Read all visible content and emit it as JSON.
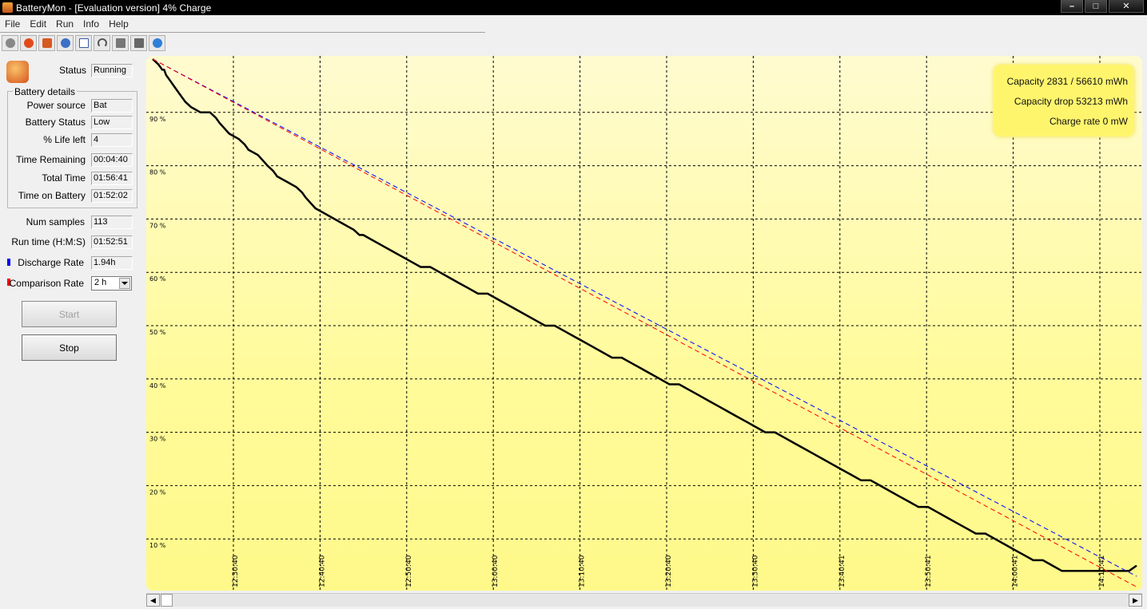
{
  "window": {
    "title": "BatteryMon - [Evaluation version] 4% Charge",
    "controls": [
      "–",
      "□",
      "✕"
    ]
  },
  "menu": [
    "File",
    "Edit",
    "Run",
    "Info",
    "Help"
  ],
  "toolbar": [
    "record-icon",
    "stop-icon",
    "battery-icon",
    "settings-icon",
    "checklist-icon",
    "gauge-icon",
    "chart-icon",
    "arrow-icon",
    "help-icon"
  ],
  "status": {
    "label": "Status",
    "value": "Running"
  },
  "battery_details": {
    "title": "Battery details",
    "fields": [
      {
        "label": "Power source",
        "value": "Bat"
      },
      {
        "label": "Battery Status",
        "value": "Low"
      },
      {
        "label": "% Life left",
        "value": "4"
      },
      {
        "label": "Time Remaining",
        "value": "00:04:40"
      },
      {
        "label": "Total Time",
        "value": "01:56:41"
      },
      {
        "label": "Time on Battery",
        "value": "01:52:02"
      }
    ]
  },
  "stats": [
    {
      "label": "Num samples",
      "value": "113"
    },
    {
      "label": "Run time (H:M:S)",
      "value": "01:52:51"
    },
    {
      "label": "Discharge Rate",
      "value": "1.94h",
      "color": "#0000ff"
    },
    {
      "label": "Comparison Rate",
      "value": "2 h",
      "color": "#ff0000"
    }
  ],
  "buttons": {
    "start": "Start",
    "stop": "Stop"
  },
  "info_box": [
    "Capacity 2831 / 56610 mWh",
    "Capacity drop 53213 mWh",
    "Charge rate 0 mW"
  ],
  "chart_data": {
    "type": "line",
    "y_unit": "%",
    "ylim": [
      0,
      100
    ],
    "y_ticks": [
      "10 %",
      "20 %",
      "30 %",
      "40 %",
      "50 %",
      "60 %",
      "70 %",
      "80 %",
      "90 %"
    ],
    "x_ticks": [
      "12:30:40",
      "12:40:40",
      "12:50:40",
      "13:00:40",
      "13:10:40",
      "13:20:40",
      "13:30:40",
      "13:40:41",
      "13:50:41",
      "14:00:41",
      "14:10:41"
    ],
    "grid": true,
    "series": [
      {
        "color": "#000000",
        "x_minutes": [
          0,
          3,
          5,
          6,
          7,
          9,
          11,
          13,
          15,
          17,
          20,
          25,
          30,
          33,
          35,
          40,
          45,
          48,
          50,
          55,
          60,
          63,
          65,
          70,
          75,
          78,
          80,
          85,
          90,
          95,
          100,
          105,
          108,
          110,
          115,
          120,
          125,
          130,
          135,
          140,
          145,
          150,
          155,
          160,
          165,
          170,
          175,
          180,
          185,
          190,
          195,
          200,
          205,
          210,
          215,
          220,
          225,
          230,
          235,
          240,
          245,
          250,
          255,
          260,
          265,
          270,
          275,
          280,
          285,
          290,
          295,
          300,
          305,
          310,
          315,
          320,
          325,
          330,
          335,
          340,
          345,
          350,
          355,
          360,
          365,
          370,
          375,
          380,
          385,
          390,
          395,
          400,
          405,
          410,
          415,
          420,
          425,
          430,
          435,
          440,
          445,
          450,
          455,
          460,
          465,
          470,
          475,
          480,
          485,
          490,
          495,
          500,
          505,
          510,
          514
        ],
        "values": [
          100,
          99,
          98,
          98,
          97,
          96,
          95,
          94,
          93,
          92,
          91,
          90,
          90,
          89,
          88,
          86,
          85,
          84,
          83,
          82,
          80,
          79,
          78,
          77,
          76,
          75,
          74,
          72,
          71,
          70,
          69,
          68,
          67,
          67,
          66,
          65,
          64,
          63,
          62,
          61,
          61,
          60,
          59,
          58,
          57,
          56,
          56,
          55,
          54,
          53,
          52,
          51,
          50,
          50,
          49,
          48,
          47,
          46,
          45,
          44,
          44,
          43,
          42,
          41,
          40,
          39,
          39,
          38,
          37,
          36,
          35,
          34,
          33,
          32,
          31,
          30,
          30,
          29,
          28,
          27,
          26,
          25,
          24,
          23,
          22,
          21,
          21,
          20,
          19,
          18,
          17,
          16,
          16,
          15,
          14,
          13,
          12,
          11,
          11,
          10,
          9,
          8,
          7,
          6,
          6,
          5,
          4,
          4,
          4,
          4,
          4,
          4,
          4,
          4,
          5
        ]
      },
      {
        "color": "#0000ff",
        "x_minutes": [
          0,
          514
        ],
        "values": [
          100,
          3
        ]
      },
      {
        "color": "#ff0000",
        "x_minutes": [
          0,
          514
        ],
        "values": [
          100,
          1
        ]
      }
    ]
  }
}
